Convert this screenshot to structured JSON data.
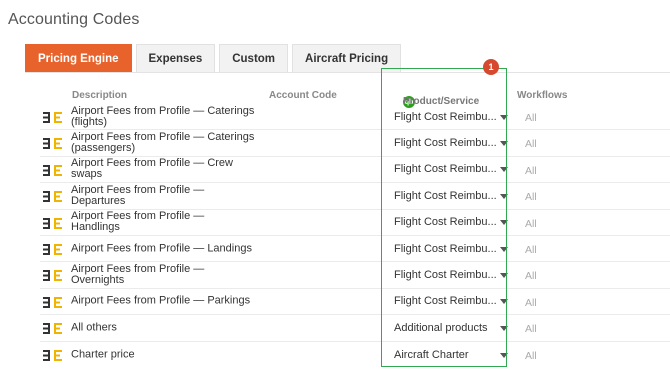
{
  "page": {
    "title": "Accounting Codes"
  },
  "tabs": [
    {
      "label": "Pricing Engine",
      "active": true
    },
    {
      "label": "Expenses",
      "active": false
    },
    {
      "label": "Custom",
      "active": false
    },
    {
      "label": "Aircraft Pricing",
      "active": false
    }
  ],
  "columns": {
    "description": "Description",
    "account_code": "Account Code",
    "product_service": "Product/Service",
    "product_service_icon": "qb",
    "workflows": "Workflows"
  },
  "rows": [
    {
      "description": "Airport Fees from Profile  —  Caterings (flights)",
      "account_code": "",
      "product": "Flight Cost Reimbu...",
      "workflows": "All"
    },
    {
      "description": "Airport Fees from Profile  —  Caterings (passengers)",
      "account_code": "",
      "product": "Flight Cost Reimbu...",
      "workflows": "All"
    },
    {
      "description": "Airport Fees from Profile  —  Crew swaps",
      "account_code": "",
      "product": "Flight Cost Reimbu...",
      "workflows": "All"
    },
    {
      "description": "Airport Fees from Profile  —  Departures",
      "account_code": "",
      "product": "Flight Cost Reimbu...",
      "workflows": "All"
    },
    {
      "description": "Airport Fees from Profile  —  Handlings",
      "account_code": "",
      "product": "Flight Cost Reimbu...",
      "workflows": "All"
    },
    {
      "description": "Airport Fees from Profile  —  Landings",
      "account_code": "",
      "product": "Flight Cost Reimbu...",
      "workflows": "All"
    },
    {
      "description": "Airport Fees from Profile  —  Overnights",
      "account_code": "",
      "product": "Flight Cost Reimbu...",
      "workflows": "All"
    },
    {
      "description": "Airport Fees from Profile  —  Parkings",
      "account_code": "",
      "product": "Flight Cost Reimbu...",
      "workflows": "All"
    },
    {
      "description": "All others",
      "account_code": "",
      "product": "Additional products",
      "workflows": "All"
    },
    {
      "description": "Charter price",
      "account_code": "",
      "product": "Aircraft Charter",
      "workflows": "All"
    }
  ],
  "annotation": {
    "callout_number": "1",
    "highlight_color": "#33a852",
    "callout_color": "#d6492f"
  },
  "colors": {
    "accent": "#e8632b",
    "row_icon_dark": "#333333",
    "row_icon_accent": "#f0b400"
  },
  "row_icon": "pricing-formula-icon"
}
